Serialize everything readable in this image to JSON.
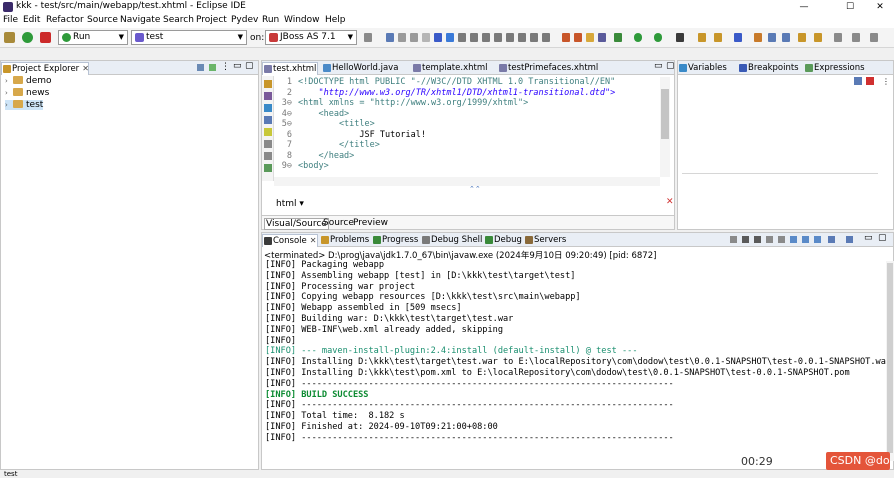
{
  "window": {
    "title": "kkk - test/src/main/webapp/test.xhtml - Eclipse IDE",
    "minimize": "—",
    "maximize": "☐",
    "close": "✕"
  },
  "menu": [
    "File",
    "Edit",
    "Refactor",
    "Source",
    "Navigate",
    "Search",
    "Project",
    "Pydev",
    "Run",
    "Window",
    "Help"
  ],
  "toolbar": {
    "run_mode": "Run",
    "run_config": "test",
    "on_label": "on:",
    "server": "JBoss AS 7.1"
  },
  "project_explorer": {
    "tab_label": "Project Explorer",
    "projects": [
      "demo",
      "news",
      "test"
    ]
  },
  "editor": {
    "tabs": [
      "test.xhtml",
      "HelloWorld.java",
      "template.xhtml",
      "testPrimefaces.xhtml"
    ],
    "lines": [
      {
        "n": "1",
        "text": "<!DOCTYPE html PUBLIC \"-//W3C//DTD XHTML 1.0 Transitional//EN\""
      },
      {
        "n": "2",
        "text": "    \"http://www.w3.org/TR/xhtml1/DTD/xhtml1-transitional.dtd\">"
      },
      {
        "n": "3⊖",
        "text": "<html xmlns = \"http://www.w3.org/1999/xhtml\">"
      },
      {
        "n": "4⊖",
        "text": "    <head>"
      },
      {
        "n": "5⊖",
        "text": "        <title>"
      },
      {
        "n": "6",
        "text": "            JSF Tutorial!"
      },
      {
        "n": "7",
        "text": "        </title>"
      },
      {
        "n": "8",
        "text": "    </head>"
      },
      {
        "n": "9⊖",
        "text": "<body>"
      }
    ],
    "html_selector": "html",
    "view_tabs": [
      "Visual/Source",
      "Source",
      "Preview"
    ]
  },
  "debug_panel": {
    "tabs": [
      "Variables",
      "Breakpoints",
      "Expressions"
    ]
  },
  "console": {
    "tabs": [
      "Console",
      "Problems",
      "Progress",
      "Debug Shell",
      "Debug",
      "Servers"
    ],
    "terminated": "<terminated> D:\\prog\\java\\jdk1.7.0_67\\bin\\javaw.exe (2024年9月10日 09:20:49) [pid: 6872]",
    "lines": [
      "[INFO] Packaging webapp",
      "[INFO] Assembling webapp [test] in [D:\\kkk\\test\\target\\test]",
      "[INFO] Processing war project",
      "[INFO] Copying webapp resources [D:\\kkk\\test\\src\\main\\webapp]",
      "[INFO] Webapp assembled in [509 msecs]",
      "[INFO] Building war: D:\\kkk\\test\\target\\test.war",
      "[INFO] WEB-INF\\web.xml already added, skipping",
      "[INFO]",
      "[INFO] --- maven-install-plugin:2.4:install (default-install) @ test ---",
      "[INFO] Installing D:\\kkk\\test\\target\\test.war to E:\\localRepository\\com\\dodow\\test\\0.0.1-SNAPSHOT\\test-0.0.1-SNAPSHOT.war",
      "[INFO] Installing D:\\kkk\\test\\pom.xml to E:\\localRepository\\com\\dodow\\test\\0.0.1-SNAPSHOT\\test-0.0.1-SNAPSHOT.pom",
      "[INFO] ------------------------------------------------------------------------",
      "[INFO] BUILD SUCCESS",
      "[INFO] ------------------------------------------------------------------------",
      "[INFO] Total time:  8.182 s",
      "[INFO] Finished at: 2024-09-10T09:21:00+08:00",
      "[INFO] ------------------------------------------------------------------------"
    ]
  },
  "status": {
    "selected": "test",
    "time": "00:29",
    "watermark": "CSDN @dodow458"
  }
}
